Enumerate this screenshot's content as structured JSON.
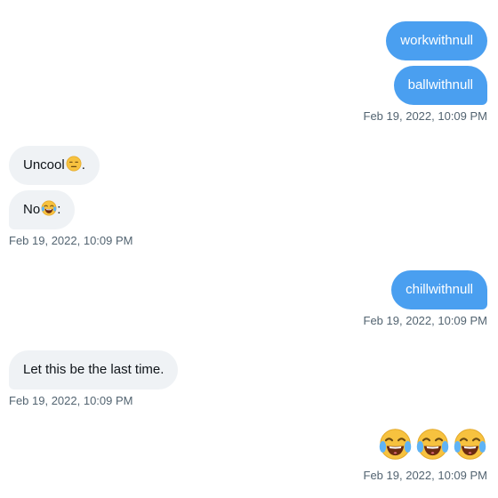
{
  "messages": [
    {
      "text": "workwithnull",
      "direction": "sent"
    },
    {
      "text": "ballwithnull",
      "direction": "sent"
    },
    {
      "text": "Uncool",
      "suffix": ".",
      "emoji": "expressionless-face-icon",
      "direction": "received"
    },
    {
      "text": "No",
      "suffix": ":",
      "emoji": "tears-of-joy-icon",
      "direction": "received"
    },
    {
      "text": "chillwithnull",
      "direction": "sent"
    },
    {
      "text": "Let this be the last time.",
      "direction": "received"
    },
    {
      "emojis": [
        "tears-of-joy-icon",
        "tears-of-joy-icon",
        "tears-of-joy-icon"
      ],
      "direction": "sent"
    }
  ],
  "timestamps": [
    "Feb 19, 2022, 10:09 PM",
    "Feb 19, 2022, 10:09 PM",
    "Feb 19, 2022, 10:09 PM",
    "Feb 19, 2022, 10:09 PM",
    "Feb 19, 2022, 10:09 PM"
  ],
  "colors": {
    "sent_bubble": "#4a9ff0",
    "received_bubble": "#eff2f5",
    "timestamp": "#536471",
    "text": "#0f1419"
  }
}
